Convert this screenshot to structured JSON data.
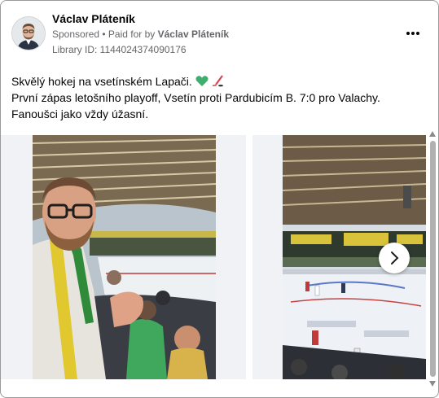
{
  "post": {
    "author": "Václav Pláteník",
    "sponsored_label": "Sponsored",
    "separator": " • ",
    "paid_for_prefix": "Paid for by ",
    "paid_for_name": "Václav Pláteník",
    "library_id": "Library ID: 1144024374090176",
    "more_icon": "more-horizontal-icon",
    "text_line1": "Skvělý hokej na vsetínském Lapači.",
    "text_line2": "První zápas letošního playoff, Vsetín proti Pardubicím B. 7:0 pro Valachy. Fanoušci jako vždy úžasní.",
    "emojis": [
      "green-heart-icon",
      "hockey-stick-icon"
    ]
  },
  "carousel": {
    "images": [
      "photo-selfie-at-hockey-arena",
      "photo-hockey-rink-game"
    ],
    "next_icon": "chevron-right-icon"
  },
  "colors": {
    "text": "#050505",
    "secondary": "#65676b",
    "tile_bg": "#f0f2f5"
  }
}
